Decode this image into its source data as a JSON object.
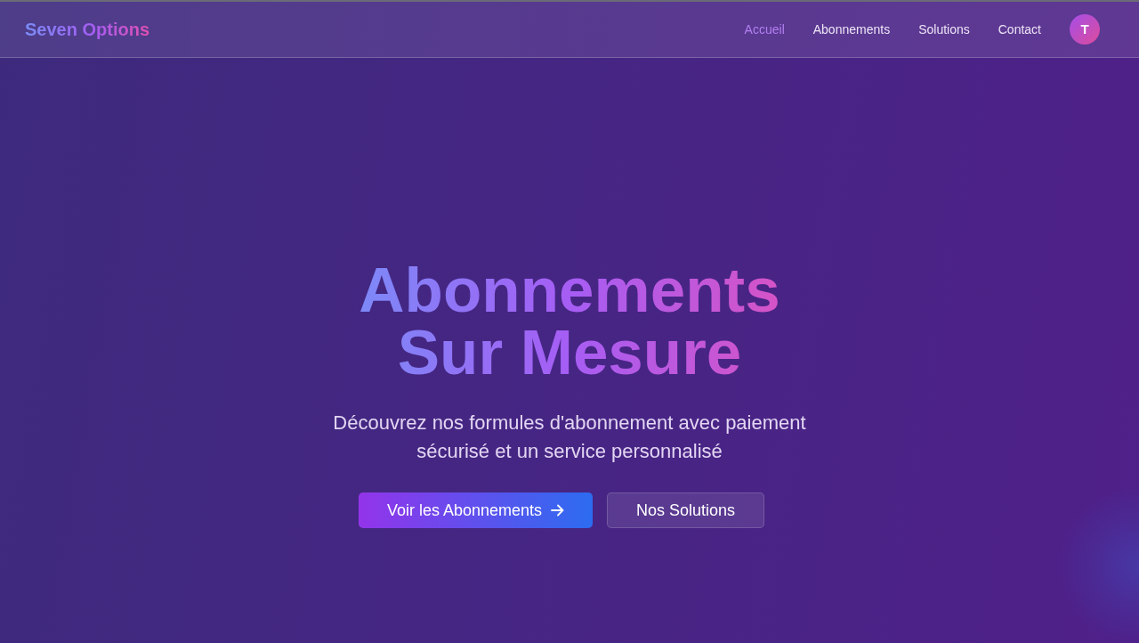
{
  "navbar": {
    "brand": "Seven Options",
    "links": [
      {
        "label": "Accueil",
        "selected": true
      },
      {
        "label": "Abonnements",
        "selected": false
      },
      {
        "label": "Solutions",
        "selected": false
      },
      {
        "label": "Contact",
        "selected": false
      }
    ],
    "avatar": {
      "initial": "T"
    }
  },
  "hero": {
    "title": "Abonnements Sur Mesure",
    "subtitle": "Découvrez nos formules d'abonnement avec paiement sécurisé et un service personnalisé",
    "buttons": [
      {
        "label": "Voir les Abonnements",
        "kind": "primary"
      },
      {
        "label": "Nos Solutions",
        "kind": "secondary"
      }
    ]
  }
}
